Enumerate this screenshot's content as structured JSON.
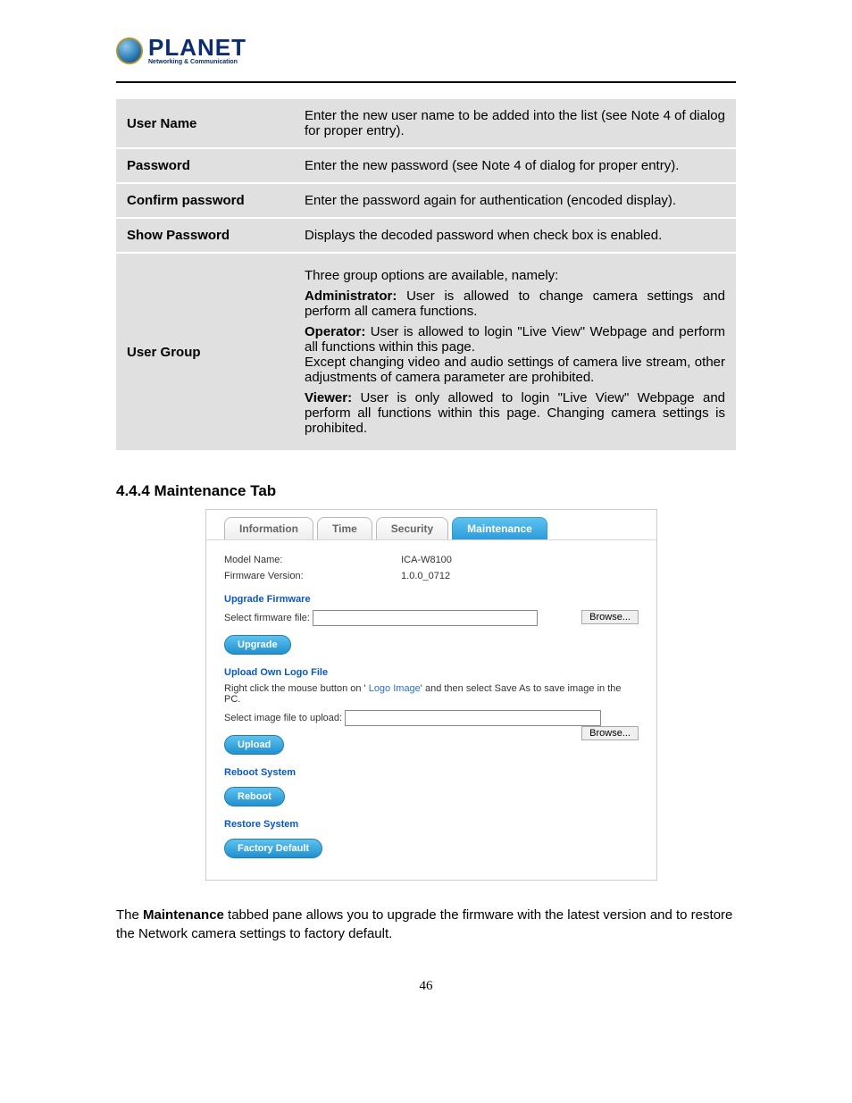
{
  "logo": {
    "brand": "PLANET",
    "tag": "Networking & Communication"
  },
  "defs": [
    {
      "key": "User Name",
      "html": "Enter the new user name to be added into the list (see Note 4 of dialog for proper entry)."
    },
    {
      "key": "Password",
      "html": "Enter the new password (see Note 4 of dialog for proper entry)."
    },
    {
      "key": "Confirm password",
      "html": "Enter the password again for authentication (encoded display)."
    },
    {
      "key": "Show Password",
      "html": "Displays the decoded password when check box is enabled."
    },
    {
      "key": "User Group",
      "html": "<p>Three group options are available, namely:</p><p><b>Administrator:</b> User is allowed to change camera settings and perform all camera functions.</p><p><b>Operator:</b> User is allowed to login \"Live View\" Webpage and perform all functions within this page.<br>Except changing video and audio settings of camera live stream, other adjustments of camera parameter are prohibited.</p><p><b>Viewer:</b> User is only allowed to login \"Live View\" Webpage and perform all functions within this page. Changing camera settings is prohibited.</p>"
    }
  ],
  "section_heading": "4.4.4 Maintenance Tab",
  "tabs": {
    "t0": "Information",
    "t1": "Time",
    "t2": "Security",
    "t3": "Maintenance"
  },
  "ui": {
    "model_label": "Model Name:",
    "model_value": "ICA-W8100",
    "fw_label": "Firmware Version:",
    "fw_value": "1.0.0_0712",
    "upgrade_title": "Upgrade Firmware",
    "fw_file_label": "Select firmware file:",
    "browse": "Browse...",
    "upgrade_btn": "Upgrade",
    "logo_title": "Upload Own Logo File",
    "logo_hint_pre": "Right click the mouse button on '",
    "logo_hint_link": " Logo Image",
    "logo_hint_post": "' and then select Save As to save image in the PC.",
    "img_file_label": "Select image file to upload:",
    "upload_btn": "Upload",
    "reboot_title": "Reboot System",
    "reboot_btn": "Reboot",
    "restore_title": "Restore System",
    "restore_btn": "Factory Default"
  },
  "caption_pre": "The ",
  "caption_bold": "Maintenance",
  "caption_post": " tabbed pane allows you to upgrade the firmware with the latest version and to restore the Network camera settings to factory default.",
  "page_no": "46"
}
